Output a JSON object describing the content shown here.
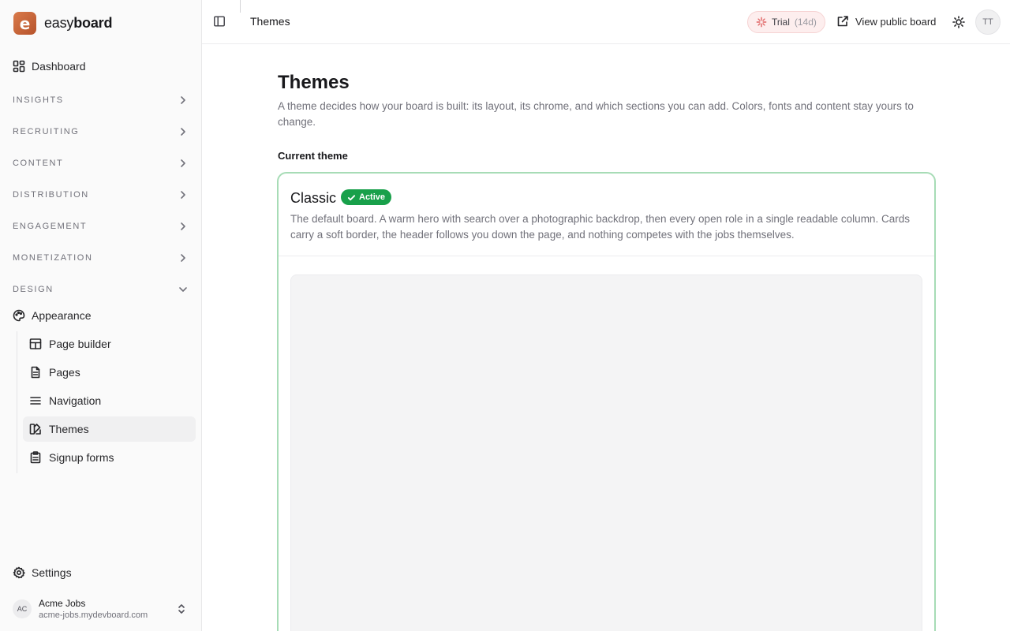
{
  "brand": {
    "logo_letter": "e",
    "name_light": "easy",
    "name_bold": "board"
  },
  "sidebar": {
    "dashboard": "Dashboard",
    "sections": [
      "INSIGHTS",
      "RECRUITING",
      "CONTENT",
      "DISTRIBUTION",
      "ENGAGEMENT",
      "MONETIZATION",
      "DESIGN"
    ],
    "appearance": "Appearance",
    "design_items": [
      "Page builder",
      "Pages",
      "Navigation",
      "Themes",
      "Signup forms"
    ],
    "settings": "Settings",
    "org": {
      "initials": "AC",
      "name": "Acme Jobs",
      "url": "acme-jobs.mydevboard.com"
    }
  },
  "topbar": {
    "title": "Themes",
    "trial_label": "Trial",
    "trial_days": "(14d)",
    "view_public": "View public board",
    "user_initials": "TT"
  },
  "main": {
    "title": "Themes",
    "description": "A theme decides how your board is built: its layout, its chrome, and which sections you can add. Colors, fonts and content stay yours to change.",
    "current_label": "Current theme",
    "theme": {
      "name": "Classic",
      "badge": "Active",
      "description": "The default board. A warm hero with search over a photographic backdrop, then every open role in a single readable column. Cards carry a soft border, the header follows you down the page, and nothing competes with the jobs themselves."
    }
  },
  "colors": {
    "active_badge": "#18a04a",
    "card_border": "#a7dcb6",
    "brand": "#c4643a",
    "trial_bg": "#fdeeee"
  }
}
